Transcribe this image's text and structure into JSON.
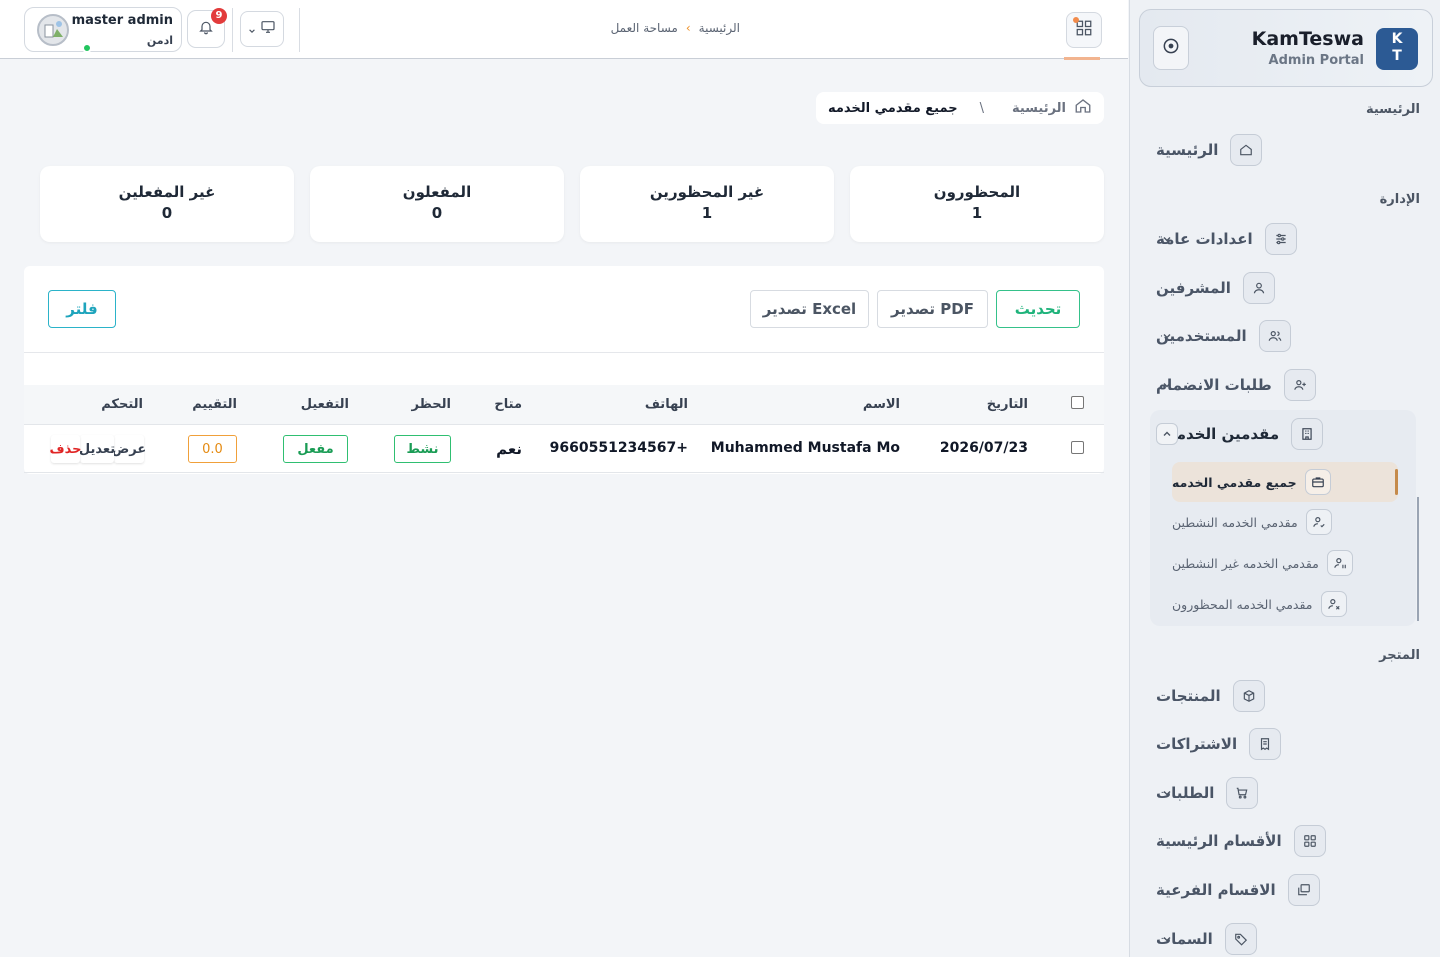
{
  "brand": {
    "title": "KamTeswa",
    "subtitle": "Admin Portal",
    "logo_line1": "K",
    "logo_line2": "T"
  },
  "topbar": {
    "breadcrumb": [
      "الرئيسية",
      "مساحة العمل"
    ],
    "user": {
      "name": "master admin",
      "role": "ادمن"
    },
    "notifications_count": "9"
  },
  "sidebar": {
    "sections": {
      "home": "الرئيسية",
      "admin": "الإدارة",
      "store": "المتجر"
    },
    "home_item": "الرئيسية",
    "admin_items": [
      "اعدادات عامة",
      "المشرفين",
      "المستخدمين",
      "طلبات الانضمام",
      "مقدمين الخدمات"
    ],
    "providers_sub": [
      "جميع مقدمي الخدمه",
      "مقدمي الخدمه النشطين",
      "مقدمي الخدمه غير النشطين",
      "مقدمي الخدمه المحظورون"
    ],
    "store_items": [
      "المنتجات",
      "الاشتراكات",
      "الطلبات",
      "الأقسام الرئيسية",
      "الاقسام الفرعية",
      "السمات"
    ]
  },
  "breadcrumb": {
    "home": "الرئيسية",
    "separator": "\\",
    "current": "جميع مقدمي الخدمه"
  },
  "stats": [
    {
      "title": "المحظورون",
      "value": "1"
    },
    {
      "title": "غير المحظورين",
      "value": "1"
    },
    {
      "title": "المفعلون",
      "value": "0"
    },
    {
      "title": "غير المفعلين",
      "value": "0"
    }
  ],
  "toolbar": {
    "refresh": "تحديث",
    "pdf": "تصدير PDF",
    "excel": "تصدير Excel",
    "filter": "فلتر"
  },
  "table": {
    "headers": {
      "date": "التاريخ",
      "name": "الاسم",
      "phone": "الهاتف",
      "available": "متاح",
      "ban": "الحظر",
      "activation": "التفعيل",
      "rating": "التقييم",
      "control": "التحكم"
    },
    "rows": [
      {
        "date": "2026/07/23",
        "name": "Muhammed Mustafa Mo",
        "phone": "9660551234567+",
        "available": "نعم",
        "ban": "نشط",
        "activation": "مفعل",
        "rating": "0.0",
        "actions": {
          "view": "عرض",
          "edit": "تعديل",
          "delete": "حذف"
        }
      }
    ]
  },
  "colors": {
    "accent": "#c58a4a",
    "brand": "#2c5a94",
    "success": "#1fb37b",
    "danger": "#e02424",
    "info": "#1ea4bc"
  }
}
